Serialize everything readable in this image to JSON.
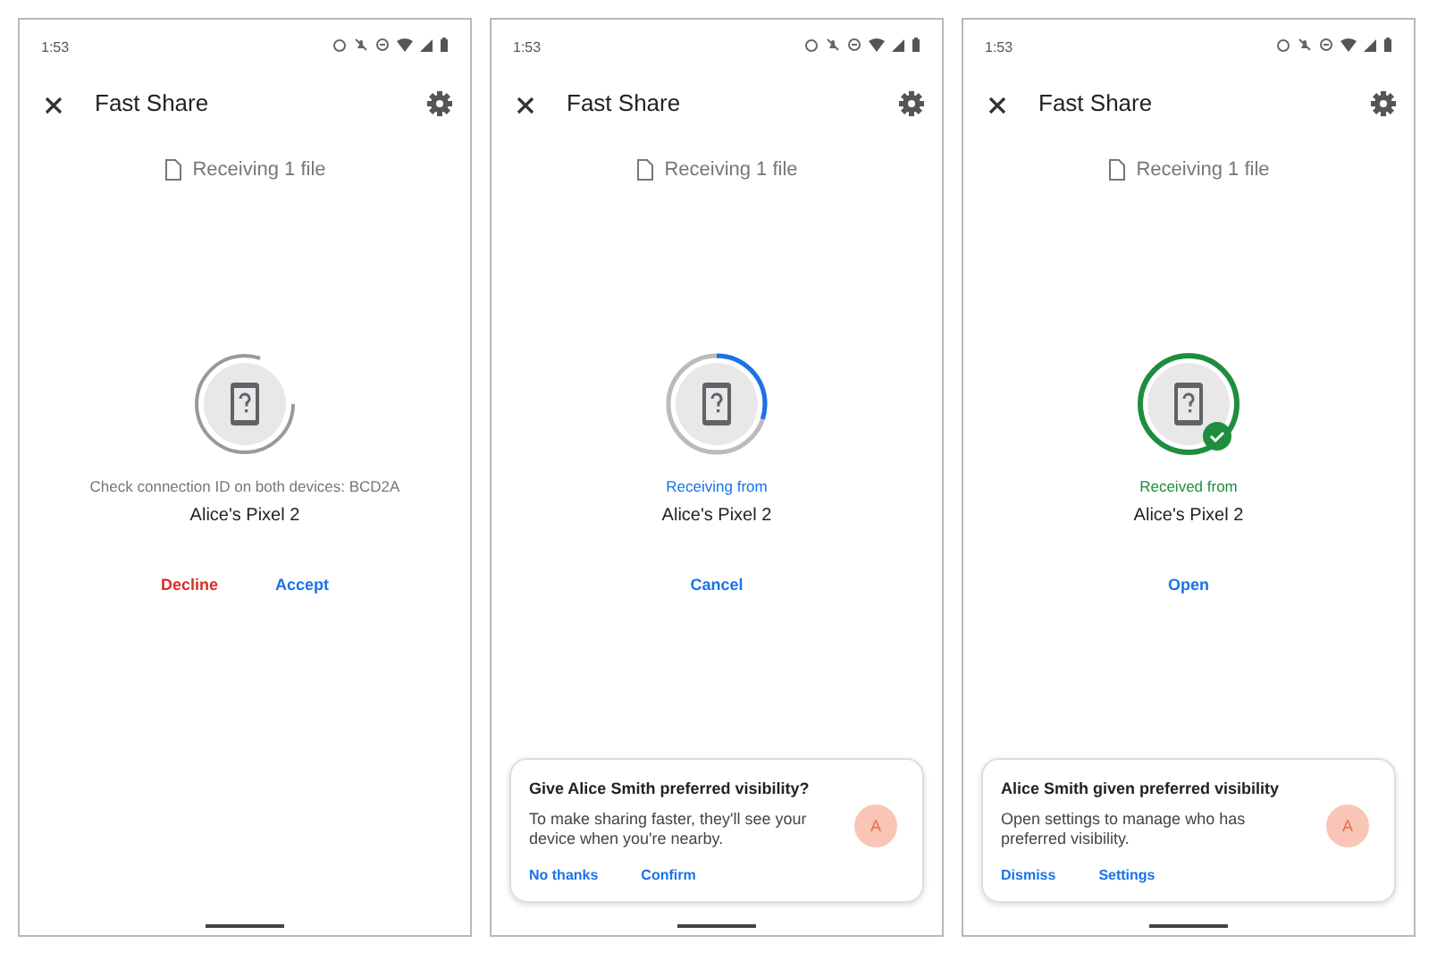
{
  "screens": [
    {
      "status_bar": {
        "time": "1:53"
      },
      "title": "Fast Share",
      "file_label": "Receiving 1 file",
      "transfer": {
        "kind": "pending",
        "status": "Check connection ID on both devices: BCD2A",
        "device": "Alice's Pixel 2"
      },
      "actions": [
        {
          "label": "Decline",
          "kind": "negative"
        },
        {
          "label": "Accept",
          "kind": "positive"
        }
      ]
    },
    {
      "status_bar": {
        "time": "1:53"
      },
      "title": "Fast Share",
      "file_label": "Receiving 1 file",
      "transfer": {
        "kind": "receiving",
        "level": 0.3,
        "status": "Receiving from",
        "device": "Alice's Pixel 2"
      },
      "actions": [
        {
          "label": "Cancel",
          "kind": "positive"
        }
      ],
      "card": {
        "title": "Give Alice Smith preferred visibility?",
        "body": "To make sharing faster, they'll see your device when you're nearby.",
        "avatar": "A",
        "actions": [
          "No thanks",
          "Confirm"
        ]
      }
    },
    {
      "status_bar": {
        "time": "1:53"
      },
      "title": "Fast Share",
      "file_label": "Receiving 1 file",
      "transfer": {
        "kind": "received",
        "status": "Received from",
        "device": "Alice's Pixel 2"
      },
      "actions": [
        {
          "label": "Open",
          "kind": "positive"
        }
      ],
      "card": {
        "title": "Alice Smith given preferred visibility",
        "body": "Open settings to manage who has preferred visibility.",
        "avatar": "A",
        "actions": [
          "Dismiss",
          "Settings"
        ]
      }
    }
  ]
}
